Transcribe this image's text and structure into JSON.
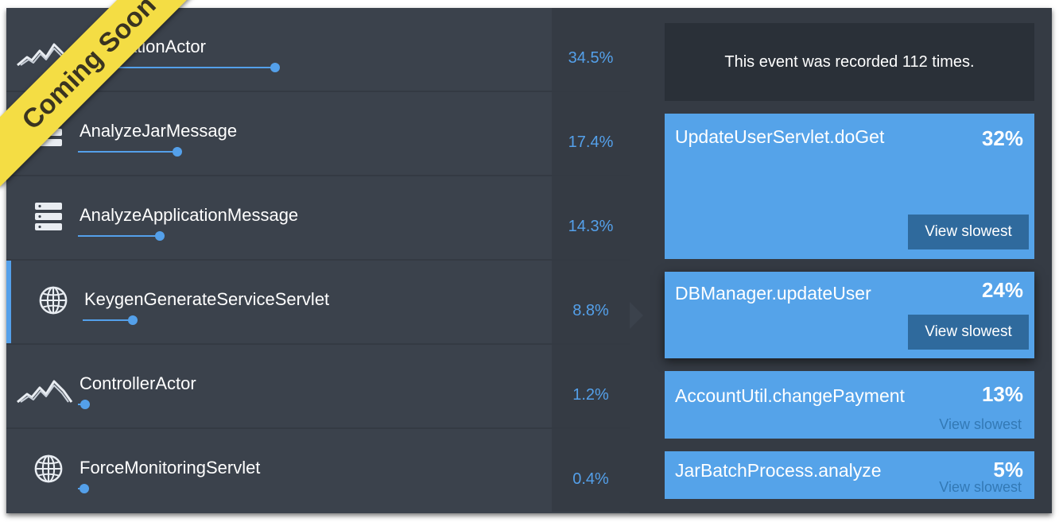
{
  "ribbon": "Coming Soon",
  "rows": [
    {
      "name": "ApplicationActor",
      "percent": "34.5%",
      "bar": 34.5,
      "icon": "mountains-icon",
      "selected": false
    },
    {
      "name": "AnalyzeJarMessage",
      "percent": "17.4%",
      "bar": 17.4,
      "icon": "server-icon",
      "selected": false
    },
    {
      "name": "AnalyzeApplicationMessage",
      "percent": "14.3%",
      "bar": 14.3,
      "icon": "server-icon",
      "selected": false
    },
    {
      "name": "KeygenGenerateServiceServlet",
      "percent": "8.8%",
      "bar": 8.8,
      "icon": "globe-icon",
      "selected": true
    },
    {
      "name": "ControllerActor",
      "percent": "1.2%",
      "bar": 1.2,
      "icon": "mountains-icon",
      "selected": false
    },
    {
      "name": "ForceMonitoringServlet",
      "percent": "0.4%",
      "bar": 0.4,
      "icon": "globe-icon",
      "selected": false
    }
  ],
  "info": "This event was recorded 112 times.",
  "cards": [
    {
      "name": "UpdateUserServlet.doGet",
      "percent": "32%",
      "action": "View slowest",
      "style": "button"
    },
    {
      "name": "DBManager.updateUser",
      "percent": "24%",
      "action": "View slowest",
      "style": "button"
    },
    {
      "name": "AccountUtil.changePayment",
      "percent": "13%",
      "action": "View slowest",
      "style": "link"
    },
    {
      "name": "JarBatchProcess.analyze",
      "percent": "5%",
      "action": "View slowest",
      "style": "link"
    }
  ],
  "colors": {
    "accent": "#54a0ea",
    "card": "#55a3e9",
    "button": "#2f6a9d",
    "ribbon": "#f4dd44"
  }
}
